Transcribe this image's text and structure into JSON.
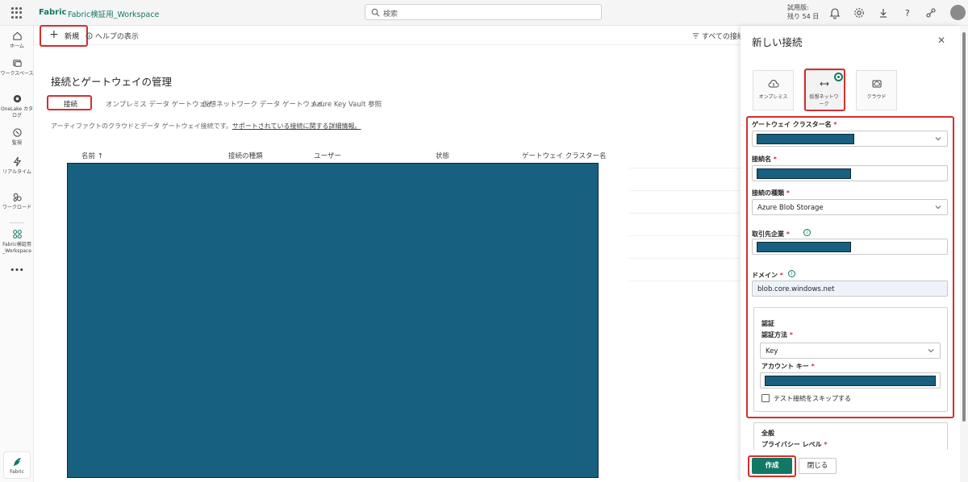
{
  "topbar": {
    "brand": "Fabric",
    "workspace": "Fabric検証用_Workspace",
    "search_placeholder": "検索",
    "trial_line1": "試用版:",
    "trial_line2": "残り 54 日"
  },
  "leftnav": {
    "items": [
      {
        "label": "ホーム",
        "icon": "home-icon"
      },
      {
        "label": "ワークスペース",
        "icon": "workspaces-icon"
      },
      {
        "label": "OneLake カタログ",
        "icon": "onelake-icon"
      },
      {
        "label": "監視",
        "icon": "monitor-icon"
      },
      {
        "label": "リアルタイム",
        "icon": "realtime-icon"
      },
      {
        "label": "ワークロード",
        "icon": "workload-icon"
      },
      {
        "label": "Fabric検証用_Workspace",
        "icon": "workspace-group-icon"
      }
    ],
    "more": "•••",
    "switcher_label": "Fabric"
  },
  "command_bar": {
    "new_label": "新規",
    "help_label": "ヘルプの表示",
    "all_connections_label": "すべての接続"
  },
  "main": {
    "title": "接続とゲートウェイの管理",
    "tabs": [
      "接続",
      "オンプレミス データ ゲートウェイ",
      "仮想ネットワーク データ ゲートウェイ",
      "Azure Key Vault 参照"
    ],
    "description": "アーティファクトのクラウドとデータ ゲートウェイ接続です。",
    "description_link": "サポートされている接続に関する詳細情報。",
    "columns": [
      "名前 ↑",
      "接続の種類",
      "ユーザー",
      "状態",
      "ゲートウェイ クラスター名"
    ]
  },
  "panel": {
    "title": "新しい接続",
    "close": "✕",
    "tiles": [
      "オンプレミス",
      "仮想ネットワーク",
      "クラウド"
    ],
    "fields": {
      "gateway_cluster_label": "ゲートウェイ クラスター名",
      "connection_name_label": "接続名",
      "connection_type_label": "接続の種類",
      "connection_type_value": "Azure Blob Storage",
      "account_label": "取引先企業",
      "domain_label": "ドメイン",
      "domain_value": "blob.core.windows.net",
      "required_mark": "*"
    },
    "auth": {
      "section_title": "認証",
      "method_label": "認証方法",
      "method_value": "Key",
      "account_key_label": "アカウント キー",
      "skip_test_label": "テスト接続をスキップする"
    },
    "general": {
      "section_title": "全般",
      "privacy_label": "プライバシー レベル"
    },
    "footer": {
      "create": "作成",
      "close": "閉じる"
    }
  },
  "colors": {
    "accent": "#117865",
    "redaction": "#17607f",
    "highlight": "#d32f2f"
  }
}
